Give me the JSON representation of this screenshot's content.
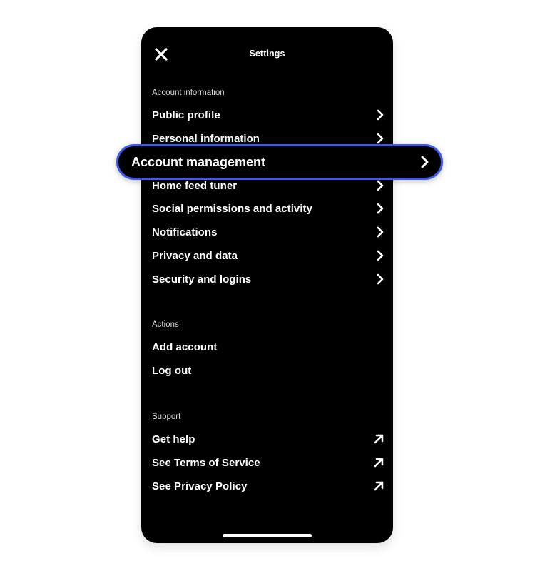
{
  "header": {
    "title": "Settings",
    "close_icon": "close-icon"
  },
  "sections": {
    "account_information": {
      "title": "Account information",
      "items": [
        {
          "label": "Public profile",
          "icon": "chevron-right-icon"
        },
        {
          "label": "Personal information",
          "icon": "chevron-right-icon"
        },
        {
          "label": "Account management",
          "icon": "chevron-right-icon",
          "highlighted": true
        },
        {
          "label": "Home feed tuner",
          "icon": "chevron-right-icon"
        },
        {
          "label": "Social permissions and activity",
          "icon": "chevron-right-icon"
        },
        {
          "label": "Notifications",
          "icon": "chevron-right-icon"
        },
        {
          "label": "Privacy and data",
          "icon": "chevron-right-icon"
        },
        {
          "label": "Security and logins",
          "icon": "chevron-right-icon"
        }
      ]
    },
    "actions": {
      "title": "Actions",
      "items": [
        {
          "label": "Add account"
        },
        {
          "label": "Log out"
        }
      ]
    },
    "support": {
      "title": "Support",
      "items": [
        {
          "label": "Get help",
          "icon": "external-link-arrow-icon"
        },
        {
          "label": "See Terms of Service",
          "icon": "external-link-arrow-icon"
        },
        {
          "label": "See Privacy Policy",
          "icon": "external-link-arrow-icon"
        }
      ]
    }
  },
  "colors": {
    "background": "#000000",
    "text": "#ffffff",
    "highlight_border": "#3e5ae8"
  }
}
